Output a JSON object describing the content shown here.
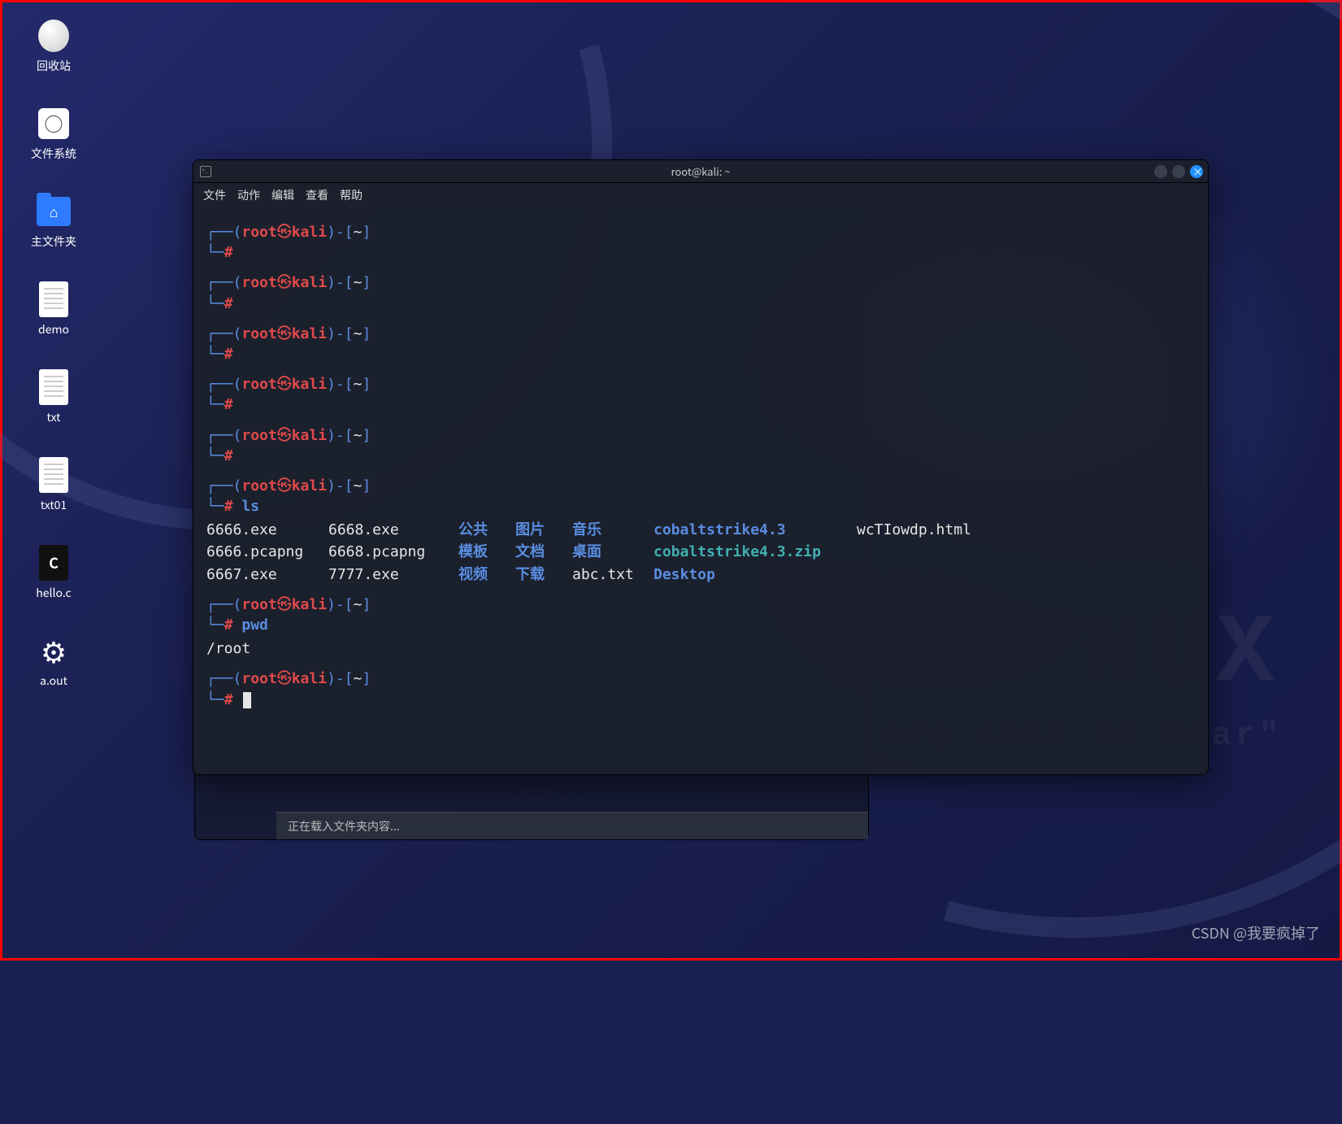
{
  "desktop": {
    "icons": [
      {
        "name": "trash",
        "label": "回收站"
      },
      {
        "name": "filesystem",
        "label": "文件系统"
      },
      {
        "name": "home",
        "label": "主文件夹"
      },
      {
        "name": "demo",
        "label": "demo"
      },
      {
        "name": "txt",
        "label": "txt"
      },
      {
        "name": "txt01",
        "label": "txt01"
      },
      {
        "name": "hello-c",
        "label": "hello.c"
      },
      {
        "name": "aout",
        "label": "a.out"
      }
    ]
  },
  "bg": {
    "line1": "NUX",
    "line2": "are able to hear\""
  },
  "terminal": {
    "title": "root@kali: ~",
    "menu": [
      "文件",
      "动作",
      "编辑",
      "查看",
      "帮助"
    ],
    "prompt": {
      "user": "root",
      "skull": "㉿",
      "host": "kali",
      "path": "~",
      "hash": "#",
      "open_corner": "┌──",
      "lower_corner": "└─",
      "paren_open": "(",
      "paren_close": ")",
      "dash": "-",
      "bracket_open": "[",
      "bracket_close": "]"
    },
    "cmd_ls": "ls",
    "cmd_pwd": "pwd",
    "pwd_output": "/root",
    "ls": {
      "col1": [
        "6666.exe",
        "6666.pcapng",
        "6667.exe"
      ],
      "col2": [
        "6668.exe",
        "6668.pcapng",
        "7777.exe"
      ],
      "col3": [
        "公共",
        "模板",
        "视频"
      ],
      "col4": [
        "图片",
        "文档",
        "下载"
      ],
      "col5": [
        "音乐",
        "桌面",
        "abc.txt"
      ],
      "col6": [
        "cobaltstrike4.3",
        "cobaltstrike4.3.zip",
        "Desktop"
      ],
      "col7": [
        "wcTIowdp.html",
        "",
        ""
      ]
    }
  },
  "fm": {
    "status": "正在载入文件夹内容..."
  },
  "watermark": "CSDN @我要疯掉了"
}
